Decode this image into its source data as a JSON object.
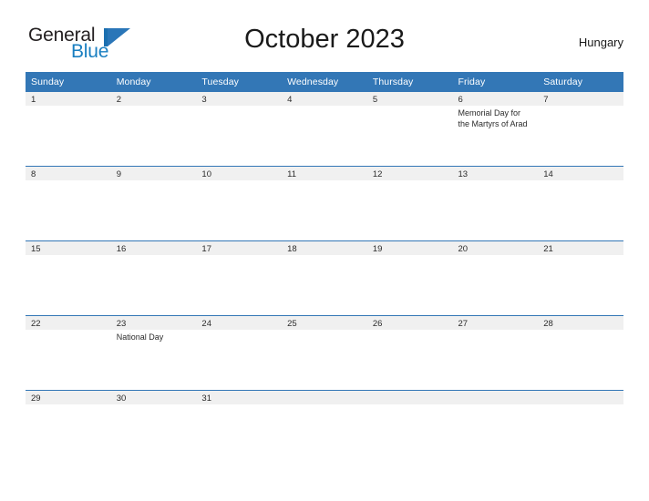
{
  "brand": {
    "name_part1": "General",
    "name_part2": "Blue",
    "logo_icon": "triangle-flag-icon",
    "color_dark": "#231f20",
    "color_blue": "#1a7fc1"
  },
  "header": {
    "title": "October 2023",
    "country": "Hungary"
  },
  "calendar": {
    "header_bg": "#3377b6",
    "date_band_bg": "#f0f0f0",
    "weekdays": [
      "Sunday",
      "Monday",
      "Tuesday",
      "Wednesday",
      "Thursday",
      "Friday",
      "Saturday"
    ],
    "weeks": [
      [
        {
          "date": "1",
          "event": ""
        },
        {
          "date": "2",
          "event": ""
        },
        {
          "date": "3",
          "event": ""
        },
        {
          "date": "4",
          "event": ""
        },
        {
          "date": "5",
          "event": ""
        },
        {
          "date": "6",
          "event": "Memorial Day for the Martyrs of Arad"
        },
        {
          "date": "7",
          "event": ""
        }
      ],
      [
        {
          "date": "8",
          "event": ""
        },
        {
          "date": "9",
          "event": ""
        },
        {
          "date": "10",
          "event": ""
        },
        {
          "date": "11",
          "event": ""
        },
        {
          "date": "12",
          "event": ""
        },
        {
          "date": "13",
          "event": ""
        },
        {
          "date": "14",
          "event": ""
        }
      ],
      [
        {
          "date": "15",
          "event": ""
        },
        {
          "date": "16",
          "event": ""
        },
        {
          "date": "17",
          "event": ""
        },
        {
          "date": "18",
          "event": ""
        },
        {
          "date": "19",
          "event": ""
        },
        {
          "date": "20",
          "event": ""
        },
        {
          "date": "21",
          "event": ""
        }
      ],
      [
        {
          "date": "22",
          "event": ""
        },
        {
          "date": "23",
          "event": "National Day"
        },
        {
          "date": "24",
          "event": ""
        },
        {
          "date": "25",
          "event": ""
        },
        {
          "date": "26",
          "event": ""
        },
        {
          "date": "27",
          "event": ""
        },
        {
          "date": "28",
          "event": ""
        }
      ],
      [
        {
          "date": "29",
          "event": ""
        },
        {
          "date": "30",
          "event": ""
        },
        {
          "date": "31",
          "event": ""
        },
        {
          "date": "",
          "event": ""
        },
        {
          "date": "",
          "event": ""
        },
        {
          "date": "",
          "event": ""
        },
        {
          "date": "",
          "event": ""
        }
      ]
    ]
  }
}
